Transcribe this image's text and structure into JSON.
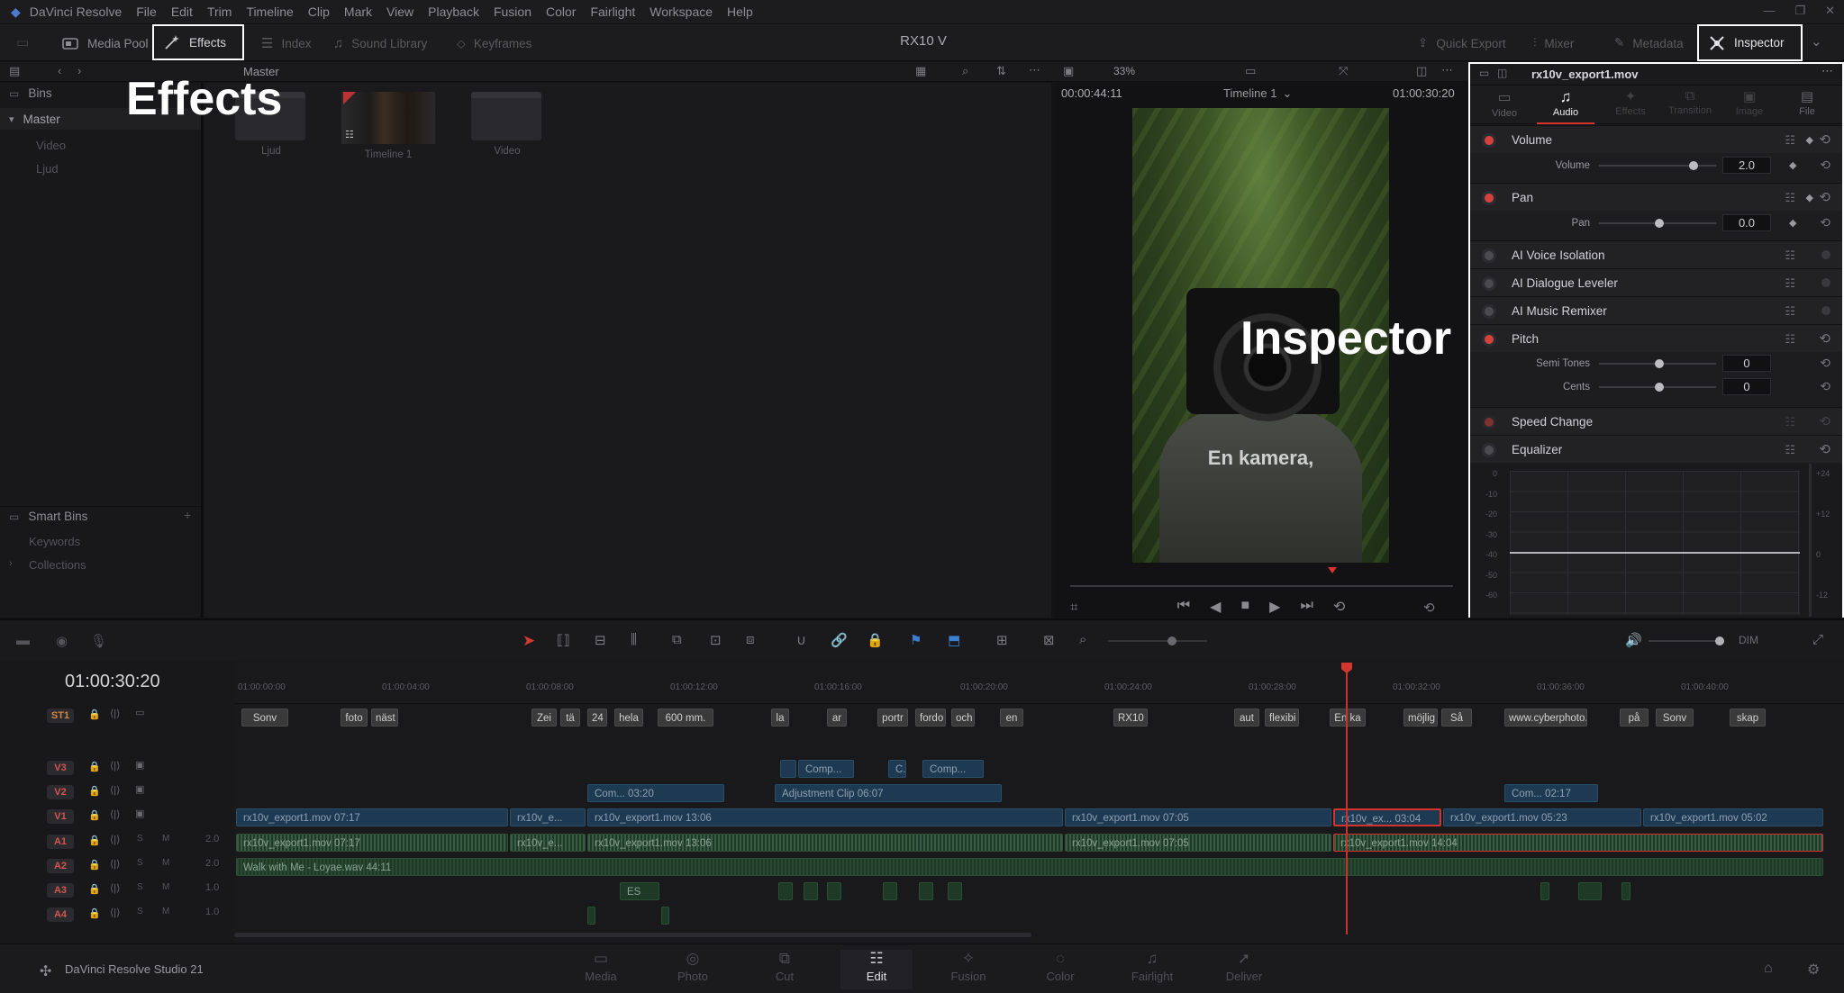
{
  "menubar": {
    "app_name": "DaVinci Resolve",
    "items": [
      "File",
      "Edit",
      "Trim",
      "Timeline",
      "Clip",
      "Mark",
      "View",
      "Playback",
      "Fusion",
      "Color",
      "Fairlight",
      "Workspace",
      "Help"
    ]
  },
  "toolbar": {
    "project_title": "RX10 V",
    "media_pool": "Media Pool",
    "effects": "Effects",
    "index": "Index",
    "sound_library": "Sound Library",
    "keyframes": "Keyframes",
    "quick_export": "Quick Export",
    "mixer": "Mixer",
    "metadata": "Metadata",
    "inspector": "Inspector"
  },
  "subbar": {
    "bin_title": "Master",
    "zoom": "33%"
  },
  "bins": {
    "header": "Bins",
    "master": "Master",
    "children": [
      "Video",
      "Ljud"
    ],
    "smart_bins": "Smart Bins",
    "smart_children": [
      "Keywords",
      "Collections"
    ]
  },
  "media": {
    "clips": [
      {
        "name": "Ljud",
        "kind": "folder"
      },
      {
        "name": "Timeline 1",
        "kind": "timeline"
      },
      {
        "name": "Video",
        "kind": "folder"
      }
    ]
  },
  "overlay_labels": {
    "effects": "Effects",
    "inspector": "Inspector"
  },
  "viewer": {
    "source_tc": "00:00:44:11",
    "timeline_name": "Timeline 1",
    "record_tc": "01:00:30:20",
    "subtitle": "En kamera,"
  },
  "inspector": {
    "clip_name": "rx10v_export1.mov",
    "tabs": [
      "Video",
      "Audio",
      "Effects",
      "Transition",
      "Image",
      "File"
    ],
    "active_tab": "Audio",
    "sections": {
      "volume": {
        "title": "Volume",
        "param": "Volume",
        "value": "2.0"
      },
      "pan": {
        "title": "Pan",
        "param": "Pan",
        "value": "0.0"
      },
      "ai_voice": "AI Voice Isolation",
      "ai_dialogue": "AI Dialogue Leveler",
      "ai_music": "AI Music Remixer",
      "pitch": {
        "title": "Pitch",
        "semi": "Semi Tones",
        "semi_value": "0",
        "cents": "Cents",
        "cents_value": "0"
      },
      "speed": "Speed Change",
      "eq": "Equalizer"
    },
    "eq_left_scale": [
      "0",
      "-10",
      "-20",
      "-30",
      "-40",
      "-50",
      "-60"
    ],
    "eq_right_scale": [
      "+24",
      "+12",
      "0",
      "-12"
    ]
  },
  "timeline": {
    "timecode": "01:00:30:20",
    "ruler": [
      "01:00:00:00",
      "01:00:04:00",
      "01:00:08:00",
      "01:00:12:00",
      "01:00:16:00",
      "01:00:20:00",
      "01:00:24:00",
      "01:00:28:00",
      "01:00:32:00",
      "01:00:36:00",
      "01:00:40:00"
    ],
    "tracks": [
      "ST1",
      "V3",
      "V2",
      "V1",
      "A1",
      "A2",
      "A3",
      "A4"
    ],
    "levels": {
      "A1": "2.0",
      "A2": "2.0",
      "A3": "1.0",
      "A4": "1.0"
    },
    "dim_label": "DIM",
    "captions": [
      "Sonv",
      "foto",
      "näst",
      "Zei",
      "tä",
      "24",
      "hela",
      "600 mm.",
      "la",
      "ar",
      "portr",
      "fordo",
      "och",
      "en",
      "RX10",
      "aut",
      "flexibi",
      "En ka",
      "möjlig",
      "Så",
      "www.cyberphoto.",
      "på",
      "Sonv",
      "skap"
    ],
    "v3_clips": [
      "Comp...",
      "C...",
      "Comp..."
    ],
    "v2_clips": [
      "Com... 03:20",
      "Adjustment Clip 06:07",
      "Com... 02:17"
    ],
    "v1_clips": [
      "rx10v_export1.mov 07:17",
      "rx10v_e...",
      "rx10v_export1.mov 13:06",
      "rx10v_export1.mov 07:05",
      "rx10v_ex... 03:04",
      "rx10v_export1.mov 05:23",
      "rx10v_export1.mov 05:02"
    ],
    "a1_clips": [
      "rx10v_export1.mov 07:17",
      "rx10v_e...",
      "rx10v_export1.mov 13:06",
      "rx10v_export1.mov 07:05",
      "rx10v_export1.mov 14:04"
    ],
    "a2_clip": "Walk with Me - Loyae.wav 44:11",
    "a3_clip": "ES"
  },
  "pagebar": {
    "brand": "DaVinci Resolve Studio 21",
    "pages": [
      "Media",
      "Photo",
      "Cut",
      "Edit",
      "Fusion",
      "Color",
      "Fairlight",
      "Deliver"
    ],
    "active": "Edit"
  }
}
